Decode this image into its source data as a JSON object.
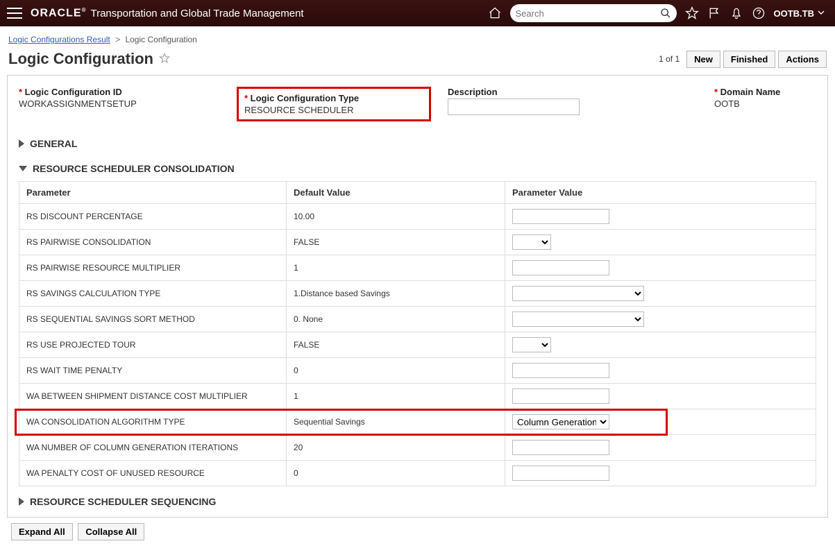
{
  "header": {
    "brand": "ORACLE",
    "product": "Transportation and Global Trade Management",
    "search_placeholder": "Search",
    "user": "OOTB.TB"
  },
  "breadcrumb": {
    "parent": "Logic Configurations Result",
    "current": "Logic Configuration"
  },
  "page": {
    "title": "Logic Configuration",
    "counter": "1 of 1",
    "btn_new": "New",
    "btn_finished": "Finished",
    "btn_actions": "Actions"
  },
  "form": {
    "id_label": "Logic Configuration ID",
    "id_value": "WORKASSIGNMENTSETUP",
    "type_label": "Logic Configuration Type",
    "type_value": "RESOURCE SCHEDULER",
    "desc_label": "Description",
    "desc_value": "",
    "domain_label": "Domain Name",
    "domain_value": "OOTB"
  },
  "sections": {
    "general": "GENERAL",
    "consolidation": "RESOURCE SCHEDULER CONSOLIDATION",
    "sequencing": "RESOURCE SCHEDULER SEQUENCING"
  },
  "table": {
    "headers": {
      "param": "Parameter",
      "def": "Default Value",
      "val": "Parameter Value"
    },
    "rows": [
      {
        "param": "RS DISCOUNT PERCENTAGE",
        "def": "10.00",
        "ctrl": "text",
        "value": ""
      },
      {
        "param": "RS PAIRWISE CONSOLIDATION",
        "def": "FALSE",
        "ctrl": "select_sm",
        "value": ""
      },
      {
        "param": "RS PAIRWISE RESOURCE MULTIPLIER",
        "def": "1",
        "ctrl": "text",
        "value": ""
      },
      {
        "param": "RS SAVINGS CALCULATION TYPE",
        "def": "1.Distance based Savings",
        "ctrl": "select_md",
        "value": ""
      },
      {
        "param": "RS SEQUENTIAL SAVINGS SORT METHOD",
        "def": "0. None",
        "ctrl": "select_md",
        "value": ""
      },
      {
        "param": "RS USE PROJECTED TOUR",
        "def": "FALSE",
        "ctrl": "select_sm",
        "value": ""
      },
      {
        "param": "RS WAIT TIME PENALTY",
        "def": "0",
        "ctrl": "text",
        "value": ""
      },
      {
        "param": "WA BETWEEN SHIPMENT DISTANCE COST MULTIPLIER",
        "def": "1",
        "ctrl": "text",
        "value": ""
      },
      {
        "param": "WA CONSOLIDATION ALGORITHM TYPE",
        "def": "Sequential Savings",
        "ctrl": "select_lg",
        "value": "Column Generation",
        "highlight": true
      },
      {
        "param": "WA NUMBER OF COLUMN GENERATION ITERATIONS",
        "def": "20",
        "ctrl": "text",
        "value": ""
      },
      {
        "param": "WA PENALTY COST OF UNUSED RESOURCE",
        "def": "0",
        "ctrl": "text",
        "value": ""
      }
    ]
  },
  "footer": {
    "expand": "Expand All",
    "collapse": "Collapse All"
  }
}
